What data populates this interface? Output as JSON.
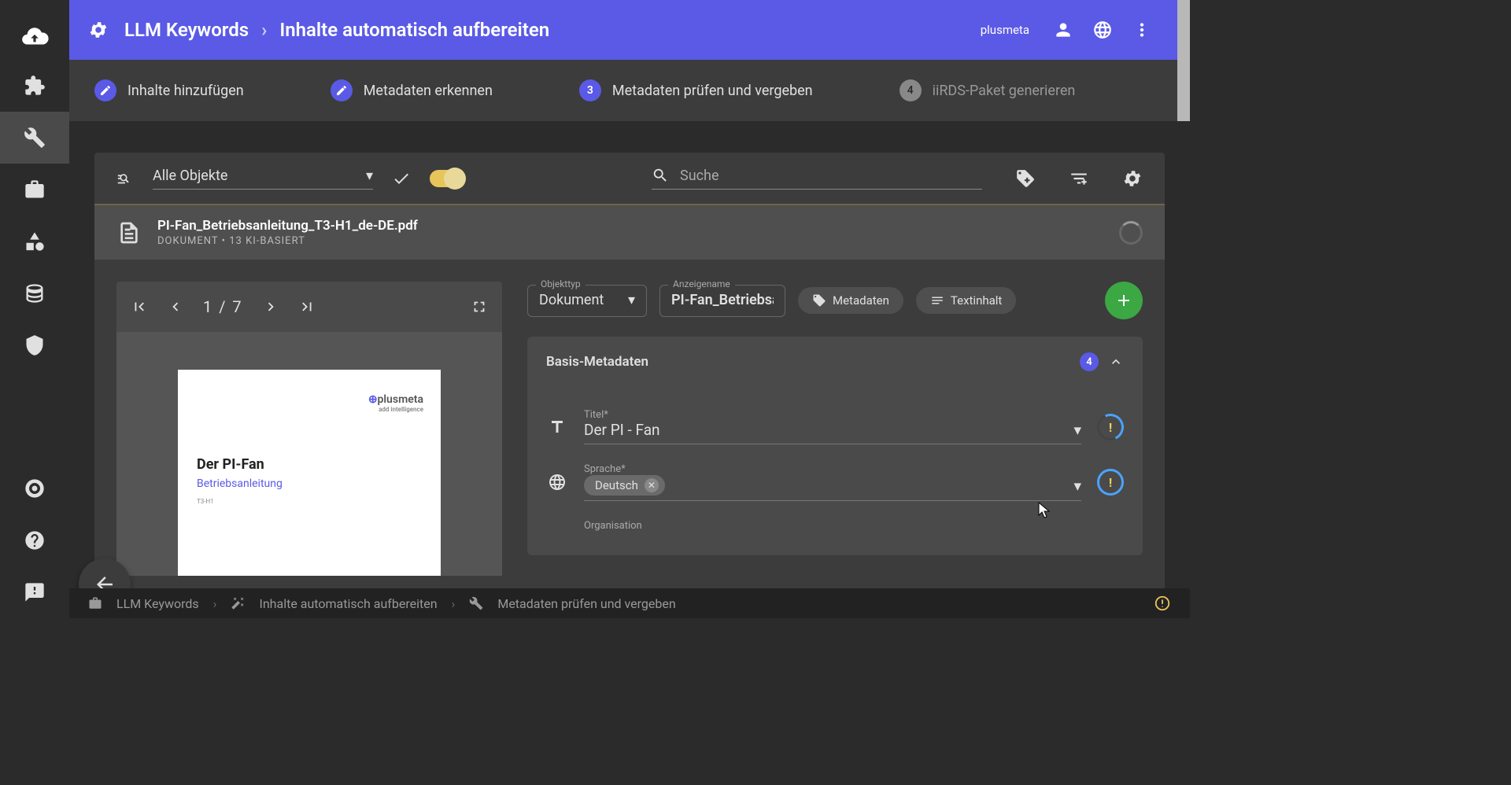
{
  "header": {
    "breadcrumb1": "LLM Keywords",
    "breadcrumb2": "Inhalte automatisch aufbereiten",
    "user": "plusmeta"
  },
  "stepper": {
    "s1": "Inhalte hinzufügen",
    "s2": "Metadaten erkennen",
    "s3num": "3",
    "s3": "Metadaten prüfen und vergeben",
    "s4num": "4",
    "s4": "iiRDS-Paket generieren"
  },
  "filter": {
    "select_label": "Alle Objekte",
    "search_placeholder": "Suche"
  },
  "document": {
    "title": "PI-Fan_Betriebsanleitung_T3-H1_de-DE.pdf",
    "subtitle": "DOKUMENT • 13 KI-BASIERT"
  },
  "pdf": {
    "page_current": "1",
    "page_total": "/ 7",
    "page_heading": "Der PI-Fan",
    "page_sub": "Betriebsanleitung",
    "page_tiny": "T3-H1",
    "brand": "plusmeta",
    "brand_tag": "add intelligence"
  },
  "meta_top": {
    "objtype_label": "Objekttyp",
    "objtype_value": "Dokument",
    "dispname_label": "Anzeigename",
    "dispname_value": "PI-Fan_Betriebsa",
    "chip_metadata": "Metadaten",
    "chip_text": "Textinhalt"
  },
  "meta_card": {
    "title": "Basis-Metadaten",
    "count": "4",
    "titel_label": "Titel*",
    "titel_value": "Der PI - Fan",
    "sprache_label": "Sprache*",
    "sprache_chip": "Deutsch",
    "org_label": "Organisation"
  },
  "bottom": {
    "b1": "LLM Keywords",
    "b2": "Inhalte automatisch aufbereiten",
    "b3": "Metadaten prüfen und vergeben"
  }
}
